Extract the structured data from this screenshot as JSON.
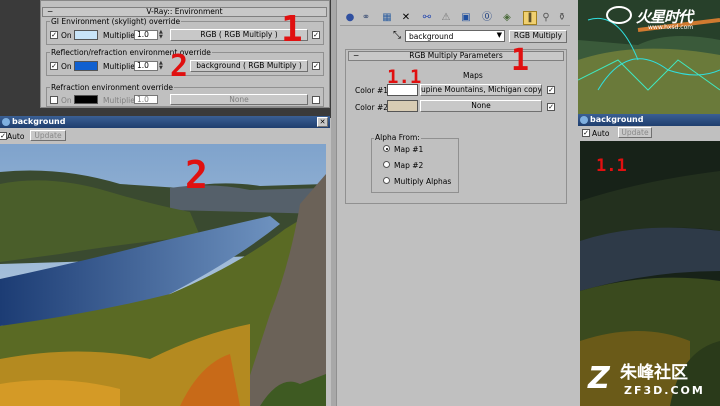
{
  "vray_panel": {
    "rollup_title": "V-Ray:: Environment",
    "gi": {
      "group_label": "GI Environment (skylight) override",
      "on_label": "On",
      "multiplier_label": "Multiplier:",
      "multiplier_value": "1.0",
      "map_button": "RGB ( RGB Multiply )"
    },
    "reflection": {
      "group_label": "Reflection/refraction environment override",
      "on_label": "On",
      "multiplier_label": "Multiplier:",
      "multiplier_value": "1.0",
      "map_button": "background ( RGB Multiply )"
    },
    "refraction": {
      "group_label": "Refraction environment override",
      "on_label": "On",
      "multiplier_label": "Multiplier:",
      "multiplier_value": "1.0",
      "map_button": "None"
    }
  },
  "material_editor": {
    "map_name": "background",
    "map_type_button": "RGB Multiply",
    "params_title": "RGB Multiply Parameters",
    "maps_label": "Maps",
    "color1_label": "Color #1:",
    "color1_map": "upine Mountains, Michigan copy.jpg)",
    "color2_label": "Color #2:",
    "color2_map": "None",
    "alpha_from_label": "Alpha From:",
    "alpha_options": [
      "Map #1",
      "Map #2",
      "Multiply Alphas"
    ]
  },
  "left_viewer": {
    "title": "background",
    "auto_label": "Auto",
    "update_label": "Update",
    "close_glyph": "✕"
  },
  "right_viewer": {
    "title": "background",
    "auto_label": "Auto",
    "update_label": "Update"
  },
  "annotations": {
    "mark_1_top": "1",
    "mark_2_mid": "2",
    "mark_1_right": "1",
    "mark_11_color": "1.1",
    "mark_2_image": "2",
    "mark_11_viewer": "1.1"
  },
  "watermarks": {
    "top_logo": "火星时代",
    "top_url": "www.hxsd.com",
    "bottom_logo": "朱峰社区",
    "bottom_url": "ZF3D.COM"
  },
  "colors": {
    "gi_swatch": "#c8e4f8",
    "reflection_swatch": "#1060d0",
    "refraction_swatch": "#000000",
    "color1_swatch": "#ffffff",
    "color2_swatch": "#d8ccb4",
    "annotation_red": "#e01010",
    "title_bar": "#2a4d80"
  }
}
